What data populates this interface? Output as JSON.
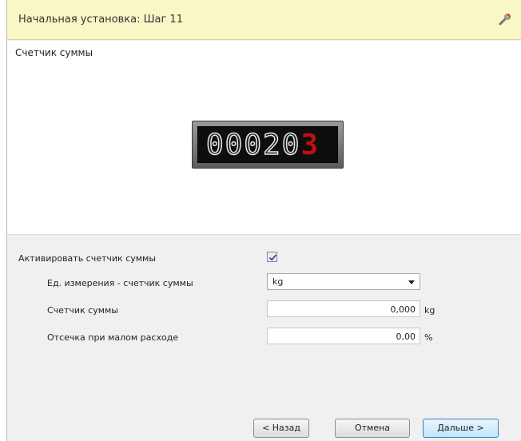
{
  "window": {
    "title": "Начальная установка: Шаг 11",
    "tool_icon": "wrench-icon"
  },
  "panel": {
    "section_title": "Счетчик суммы",
    "display": {
      "digits_white": "00020",
      "digit_red": "3"
    }
  },
  "form": {
    "activate_label": "Активировать счетчик суммы",
    "activate_checked": true,
    "unit_label": "Ед. измерения - счетчик суммы",
    "unit_value": "kg",
    "counter_label": "Счетчик суммы",
    "counter_value": "0,000",
    "counter_unit": "kg",
    "cutoff_label": "Отсечка при малом расходе",
    "cutoff_value": "0,00",
    "cutoff_unit": "%"
  },
  "footer": {
    "back_label": "< Назад",
    "cancel_label": "Отмена",
    "next_label": "Дальше >"
  },
  "colors": {
    "titlebar_bg": "#faf7c6",
    "display_red": "#c01010"
  }
}
